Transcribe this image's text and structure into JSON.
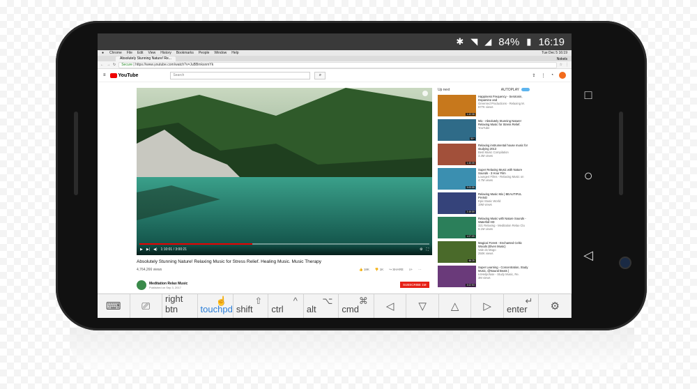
{
  "status_bar": {
    "battery": "84%",
    "time": "16:19"
  },
  "mac_menu": {
    "items": [
      "Chrome",
      "File",
      "Edit",
      "View",
      "History",
      "Bookmarks",
      "People",
      "Window",
      "Help"
    ],
    "clock": "Tue Dec 5 16:19"
  },
  "browser": {
    "tab_title": "Absolutely Stunning Nature! Re...",
    "profile": "Nokels",
    "secure": "Secure",
    "url": "https://www.youtube.com/watch?v=JuBBmksnmYk"
  },
  "youtube": {
    "logo": "YouTube",
    "search_placeholder": "Search",
    "video": {
      "time": "1:10:01 / 3:00:21",
      "title": "Absolutely Stunning Nature! Relaxing Music for Stress Relief. Healing Music. Music Therapy",
      "views": "4,764,266 views",
      "likes": "18K",
      "dislikes": "1K",
      "share": "SHARE"
    },
    "channel": {
      "name": "Meditation Relax Music",
      "published": "Published on Sep 3, 2017",
      "subscribe": "SUBSCRIBE 1M"
    },
    "up_next": {
      "label": "Up next",
      "autoplay": "AUTOPLAY"
    },
    "suggestions": [
      {
        "title": "Happiness Frequency - Serotonin, Dopamine and",
        "channel": "Greenred Productions - Relaxing M.",
        "views": "877K views",
        "duration": "1:42:08",
        "color": "#c7781c"
      },
      {
        "title": "Mix - Absolutely Stunning Nature! Relaxing Music for Stress Relief.",
        "channel": "YouTube",
        "views": "",
        "duration": "50+",
        "color": "#2f6b88"
      },
      {
        "title": "Relaxing instrumental house music for studying 2013",
        "channel": "Best Music Compilation",
        "views": "3.3M views",
        "duration": "1:40:05",
        "color": "#a2503a"
      },
      {
        "title": "Super Relaxing Music with Nature Sounds - 3 Hour Film",
        "channel": "Lounge4 Films - Relaxing Music on",
        "views": "4.7M views",
        "duration": "3:00:55",
        "color": "#3b8fb0"
      },
      {
        "title": "Relaxing Music Mix | BEAUTIFUL PIANO",
        "channel": "Epic Music World",
        "views": "19M views",
        "duration": "2:49:59",
        "color": "#35437a"
      },
      {
        "title": "Relaxing Music with Nature Sounds - Waterfall HD",
        "channel": "321 Relaxing - Meditation Relax Clu",
        "views": "9.1M views",
        "duration": "1:07:09",
        "color": "#2b7f5a"
      },
      {
        "title": "Magical Forest - Enchanted Celtic Woods (Elven Music)",
        "channel": "Vale do Mago",
        "views": "250K views",
        "duration": "46:25",
        "color": "#4a6a2a"
      },
      {
        "title": "Super Learning - Concentration, Study Music, @Naural Beats |",
        "channel": "n4Helpofuse - Study Music, Re.",
        "views": "3M views",
        "duration": "3:02:53",
        "color": "#6a3a7a"
      }
    ]
  },
  "keyboard_bar": {
    "keys": [
      {
        "name": "keyboard-key",
        "label": "",
        "icon": "⌨",
        "center": true
      },
      {
        "name": "remote-key",
        "label": "",
        "icon": "⎚",
        "center": true
      },
      {
        "name": "right-btn-key",
        "label": "right btn",
        "icon": "",
        "center": false
      },
      {
        "name": "touchpad-key",
        "label": "touchpd",
        "icon": "☝",
        "center": false,
        "active": true
      },
      {
        "name": "shift-key",
        "label": "shift",
        "icon": "⇧",
        "center": false
      },
      {
        "name": "ctrl-key",
        "label": "ctrl",
        "icon": "^",
        "center": false
      },
      {
        "name": "alt-key",
        "label": "alt",
        "icon": "⌥",
        "center": false
      },
      {
        "name": "cmd-key",
        "label": "cmd",
        "icon": "⌘",
        "center": false
      },
      {
        "name": "left-arrow-key",
        "label": "",
        "icon": "◁",
        "center": true
      },
      {
        "name": "down-arrow-key",
        "label": "",
        "icon": "▽",
        "center": true
      },
      {
        "name": "up-arrow-key",
        "label": "",
        "icon": "△",
        "center": true
      },
      {
        "name": "right-arrow-key",
        "label": "",
        "icon": "▷",
        "center": true
      },
      {
        "name": "enter-key",
        "label": "enter",
        "icon": "↵",
        "center": false
      },
      {
        "name": "settings-key",
        "label": "",
        "icon": "⚙",
        "center": true
      }
    ]
  },
  "nav_buttons": {
    "recent": "□",
    "home": "○",
    "back": "◁"
  }
}
